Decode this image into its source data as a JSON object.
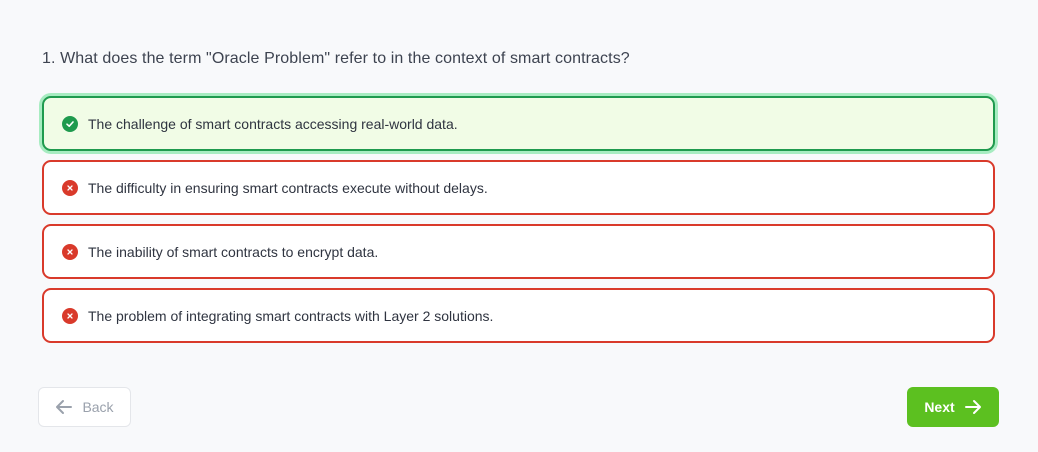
{
  "question": {
    "text": "1. What does the term \"Oracle Problem\" refer to in the context of smart contracts?"
  },
  "options": [
    {
      "label": "The challenge of smart contracts accessing real-world data.",
      "status": "correct",
      "icon": "check-circle-icon"
    },
    {
      "label": "The difficulty in ensuring smart contracts execute without delays.",
      "status": "incorrect",
      "icon": "x-circle-icon"
    },
    {
      "label": "The inability of smart contracts to encrypt data.",
      "status": "incorrect",
      "icon": "x-circle-icon"
    },
    {
      "label": "The problem of integrating smart contracts with Layer 2 solutions.",
      "status": "incorrect",
      "icon": "x-circle-icon"
    }
  ],
  "navigation": {
    "back_label": "Back",
    "next_label": "Next",
    "back_icon": "arrow-left-icon",
    "next_icon": "arrow-right-icon"
  },
  "colors": {
    "correct": "#1f9a4e",
    "incorrect": "#d93a2b",
    "next_button": "#5cc020",
    "correct_background": "#f1fce6"
  }
}
